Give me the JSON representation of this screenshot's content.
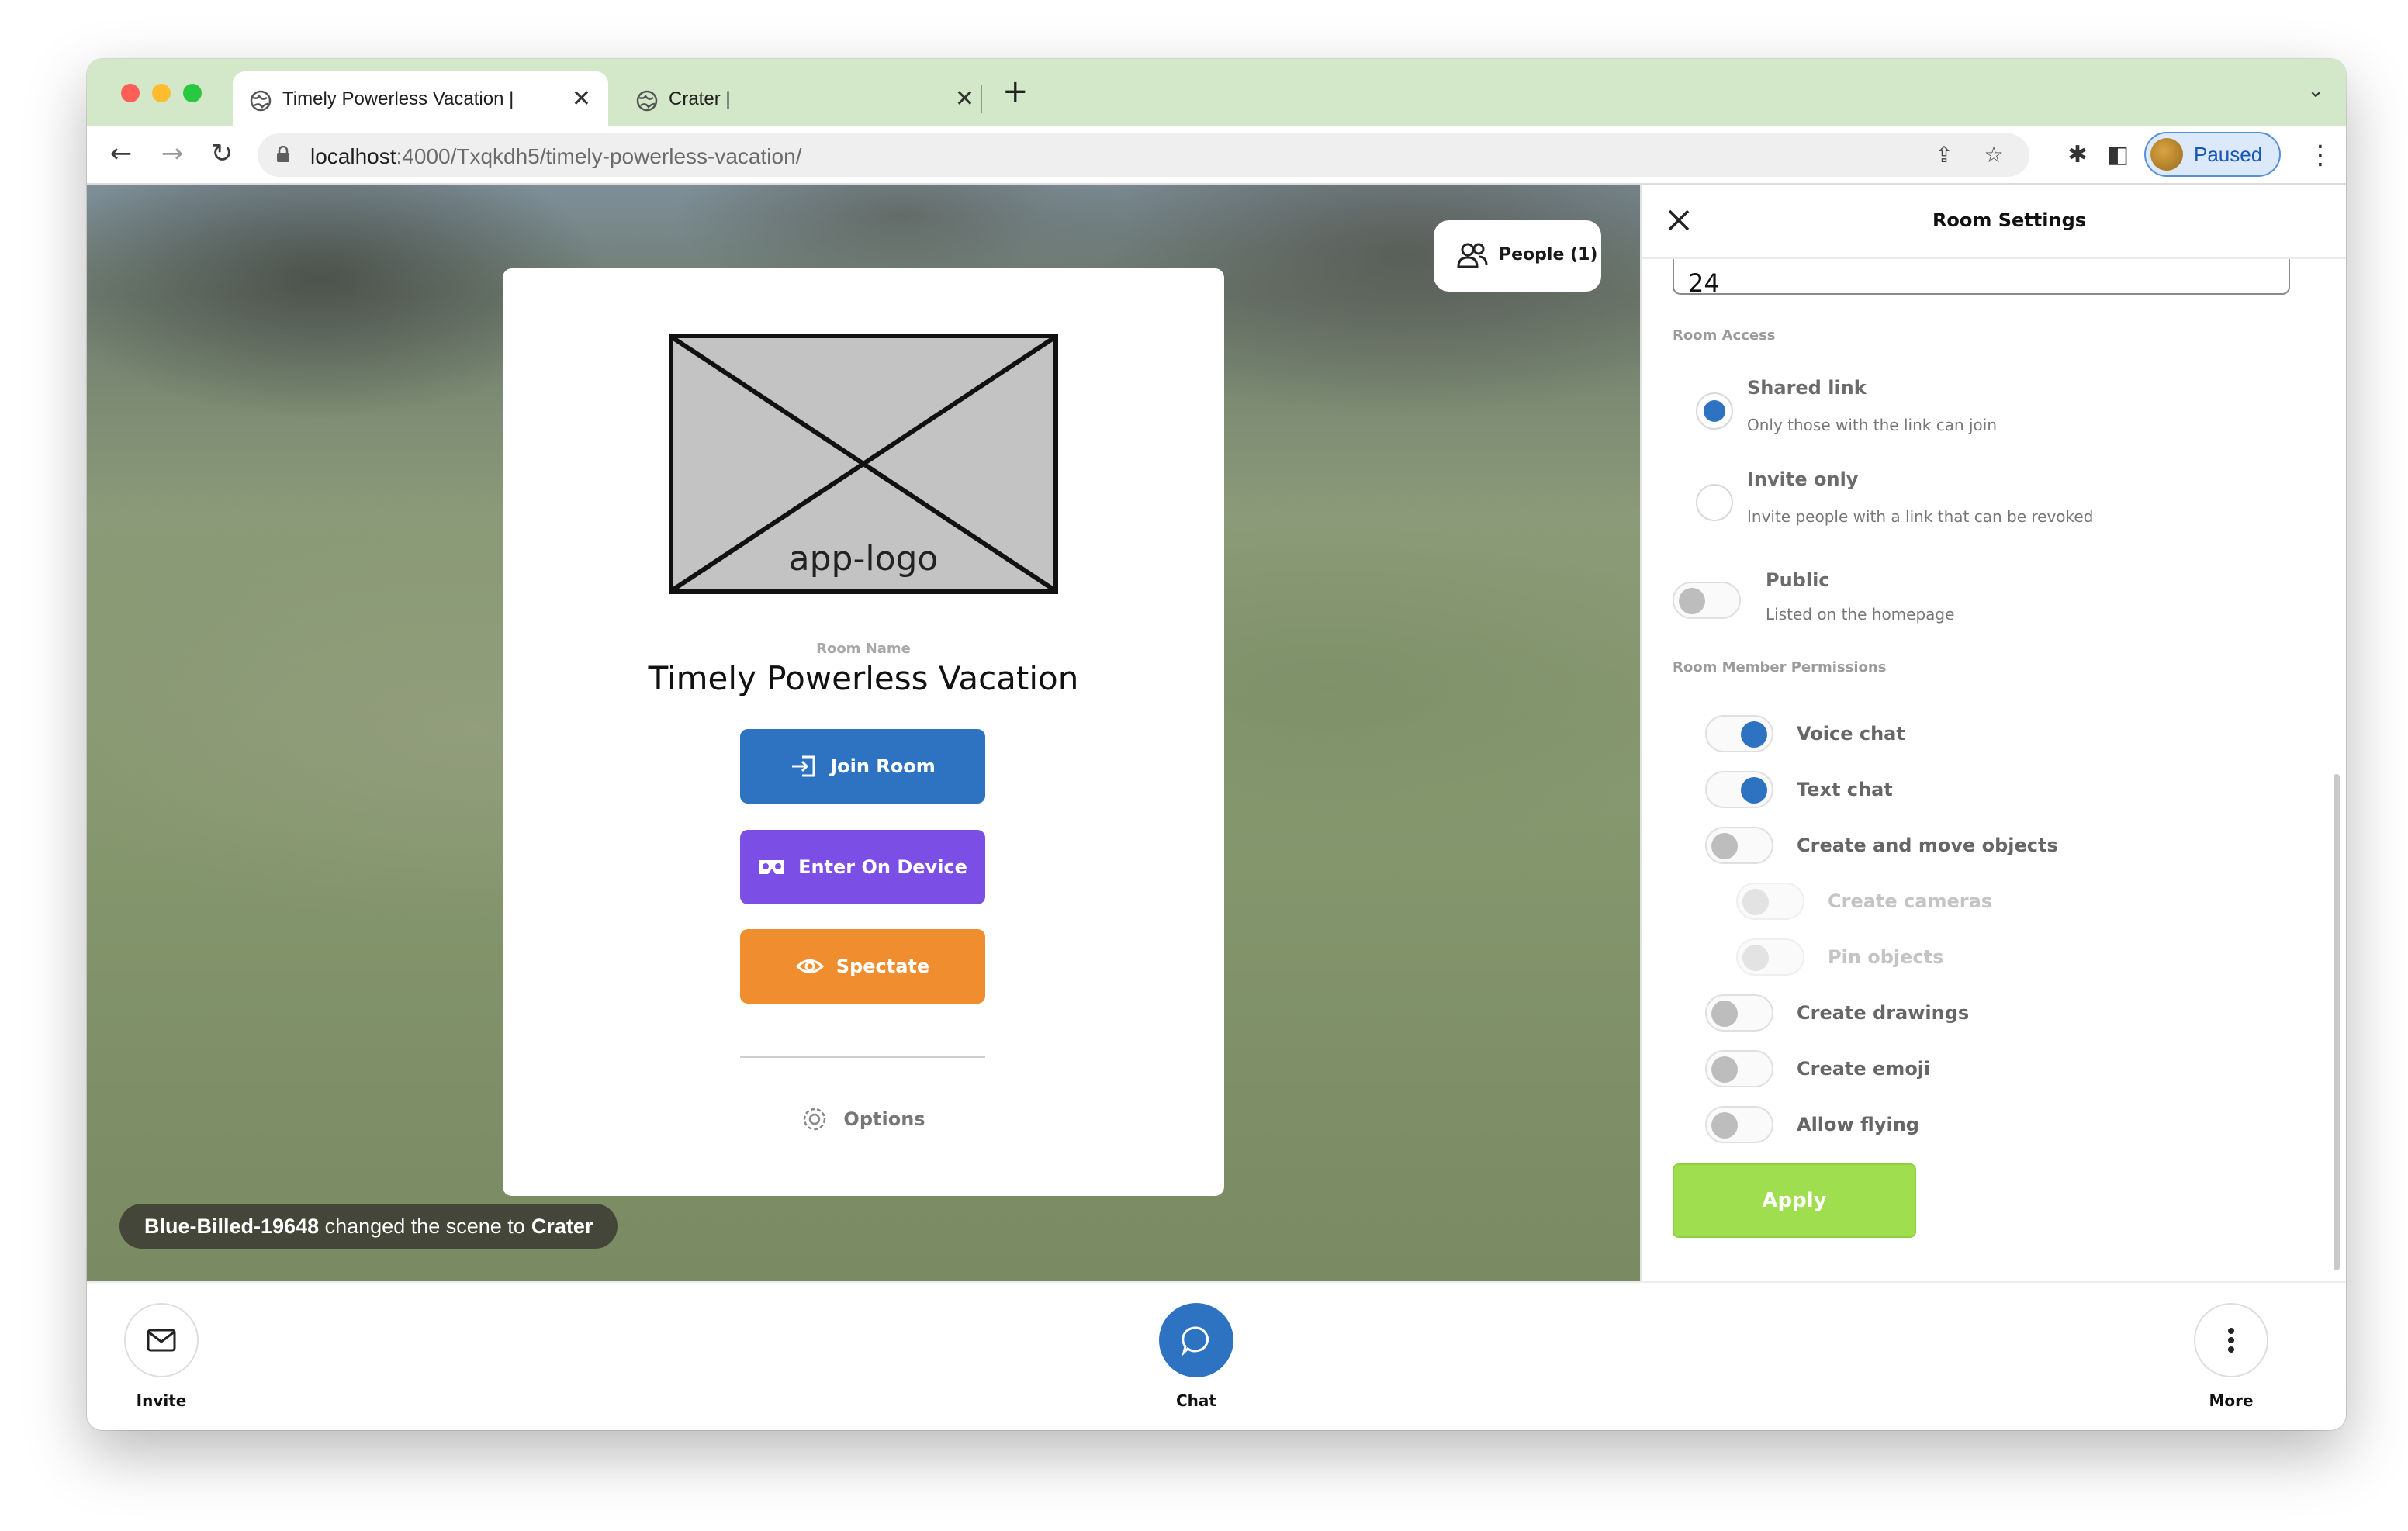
{
  "browser": {
    "tabs": [
      {
        "title": "Timely Powerless Vacation |",
        "close": "✕"
      },
      {
        "title": "Crater |",
        "close": "✕"
      }
    ],
    "new_tab": "+",
    "url_host": "localhost",
    "url_path": ":4000/Txqkdh5/timely-powerless-vacation/",
    "profile_label": "Paused"
  },
  "scene": {
    "people_button": "People (1)",
    "toast": {
      "user": "Blue-Billed-19648",
      "text": "changed the scene to",
      "scene": "Crater"
    }
  },
  "card": {
    "logo_text": "app-logo",
    "room_label": "Room Name",
    "room_name": "Timely Powerless Vacation",
    "join_label": "Join Room",
    "device_label": "Enter On Device",
    "spectate_label": "Spectate",
    "options_label": "Options"
  },
  "panel": {
    "title": "Room Settings",
    "member_limit_value": "24",
    "room_access_label": "Room Access",
    "access_options": [
      {
        "title": "Shared link",
        "subtitle": "Only those with the link can join",
        "selected": true
      },
      {
        "title": "Invite only",
        "subtitle": "Invite people with a link that can be revoked",
        "selected": false
      }
    ],
    "public": {
      "title": "Public",
      "subtitle": "Listed on the homepage",
      "on": false
    },
    "permissions_label": "Room Member Permissions",
    "permissions": [
      {
        "label": "Voice chat",
        "on": true,
        "disabled": false
      },
      {
        "label": "Text chat",
        "on": true,
        "disabled": false
      },
      {
        "label": "Create and move objects",
        "on": false,
        "disabled": false
      },
      {
        "label": "Create cameras",
        "on": false,
        "disabled": true
      },
      {
        "label": "Pin objects",
        "on": false,
        "disabled": true
      },
      {
        "label": "Create drawings",
        "on": false,
        "disabled": false
      },
      {
        "label": "Create emoji",
        "on": false,
        "disabled": false
      },
      {
        "label": "Allow flying",
        "on": false,
        "disabled": false
      }
    ],
    "apply_label": "Apply"
  },
  "bottom": {
    "invite_label": "Invite",
    "chat_label": "Chat",
    "more_label": "More"
  },
  "colors": {
    "primary_blue": "#2e73c2",
    "device_purple": "#7b4fe6",
    "spectate_orange": "#f08d2e",
    "apply_green": "#9fde4e"
  }
}
